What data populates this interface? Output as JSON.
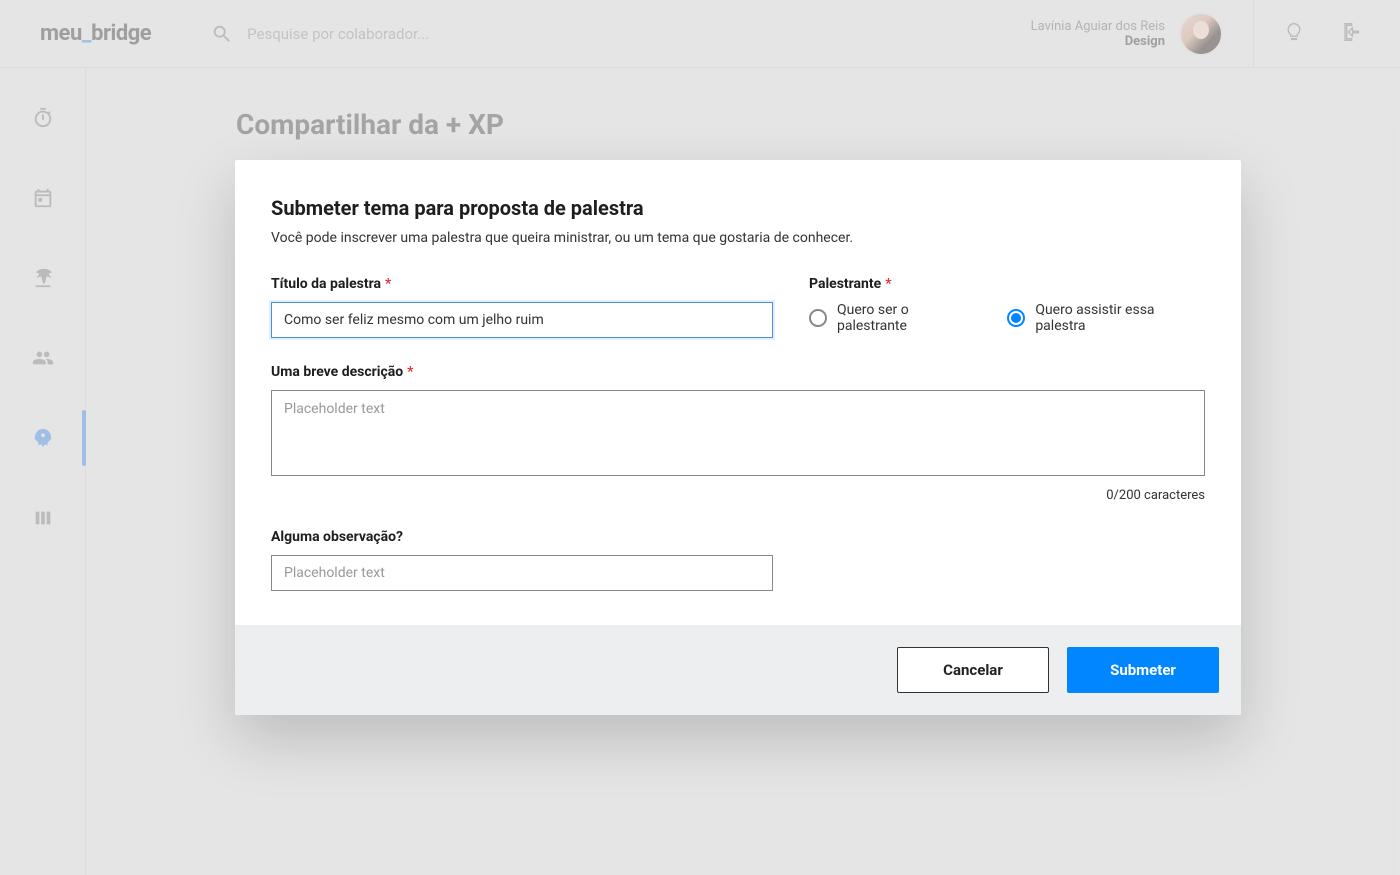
{
  "brand": {
    "pre": "meu",
    "post": "bridge"
  },
  "search": {
    "placeholder": "Pesquise por colaborador..."
  },
  "user": {
    "name": "Lavínia Aguiar dos Reis",
    "role": "Design"
  },
  "page": {
    "title": "Compartilhar da + XP"
  },
  "modal": {
    "title": "Submeter tema para proposta de palestra",
    "subtitle": "Você pode inscrever uma palestra que queira ministrar, ou um tema que gostaria de conhecer.",
    "fields": {
      "title_label": "Título da palestra",
      "title_value": "Como ser feliz mesmo com um jelho ruim",
      "speaker_label": "Palestrante",
      "radio_presenter": "Quero ser o palestrante",
      "radio_watcher": "Quero assistir essa palestra",
      "desc_label": "Uma breve descrição",
      "desc_placeholder": "Placeholder text",
      "desc_counter": "0/200 caracteres",
      "obs_label": "Alguma observação?",
      "obs_placeholder": "Placeholder text"
    },
    "actions": {
      "cancel": "Cancelar",
      "submit": "Submeter"
    }
  }
}
